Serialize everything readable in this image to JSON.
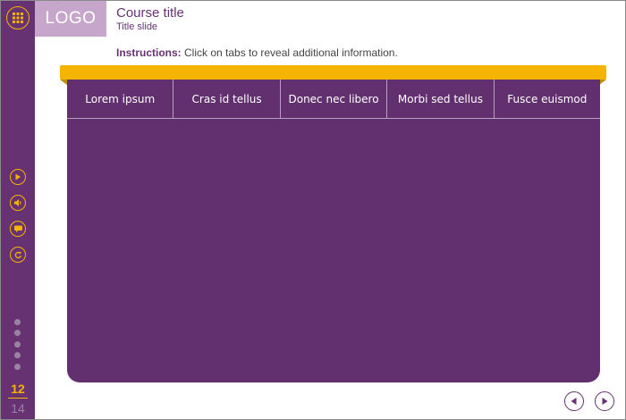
{
  "colors": {
    "primary": "#673272",
    "panel": "#62306e",
    "accent": "#f4b400",
    "logo_bg": "#c6a6cb",
    "dot": "#9a82a3"
  },
  "header": {
    "logo": "LOGO",
    "course_title": "Course title",
    "slide_title": "Title slide"
  },
  "instructions": {
    "label": "Instructions:",
    "text": " Click on tabs to reveal additional information."
  },
  "sidebar": {
    "menu_icon": "grid-menu-icon",
    "controls": [
      {
        "name": "play-icon"
      },
      {
        "name": "volume-icon"
      },
      {
        "name": "subtitles-icon"
      },
      {
        "name": "replay-icon"
      }
    ],
    "progress_dots": 5,
    "page_current": "12",
    "page_total": "14"
  },
  "tabs": [
    {
      "label": "Lorem ipsum"
    },
    {
      "label": "Cras id tellus"
    },
    {
      "label": "Donec nec libero"
    },
    {
      "label": "Morbi sed tellus"
    },
    {
      "label": "Fusce euismod"
    }
  ],
  "nav": {
    "prev_icon": "arrow-left-icon",
    "next_icon": "arrow-right-icon"
  }
}
